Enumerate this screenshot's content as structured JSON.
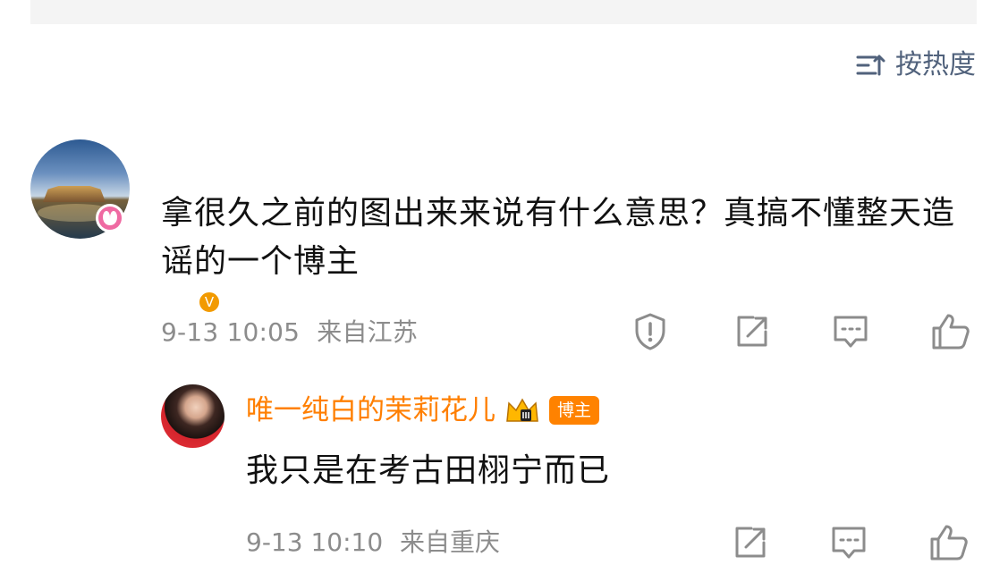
{
  "sort": {
    "label": "按热度",
    "icon": "sort-icon"
  },
  "comment": {
    "author_display": "",
    "text": "拿很久之前的图出来来说有什么意思？真搞不懂整天造谣的一个博主",
    "timestamp": "9-13 10:05",
    "location": "来自江苏",
    "icons": {
      "report": "report-icon",
      "share": "share-icon",
      "reply": "reply-icon",
      "like": "like-icon"
    }
  },
  "reply": {
    "author": "唯一纯白的茉莉花儿",
    "badge_label": "博主",
    "verify_mark": "V",
    "text": "我只是在考古田栩宁而已",
    "timestamp": "9-13 10:10",
    "location": "来自重庆",
    "icons": {
      "share": "share-icon",
      "reply": "reply-icon",
      "like": "like-icon"
    }
  },
  "colors": {
    "accent_orange": "#ff7f00",
    "sort_blue": "#51627c",
    "meta_gray": "#8c8c8c",
    "pink_badge": "#ef6aa2"
  }
}
